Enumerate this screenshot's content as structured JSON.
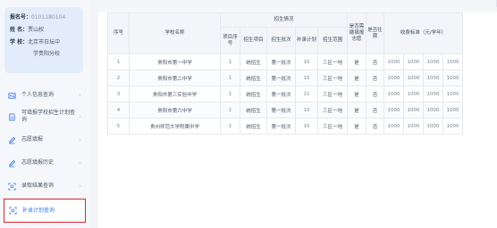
{
  "profile": {
    "exam_no_label": "报名号：",
    "exam_no_value": "0101180104",
    "name_label": "姓  名：",
    "name_value": "贾山权",
    "school_label": "学  校：",
    "school_value_1": "北京市日坛中",
    "school_value_2": "学贵阳分校"
  },
  "menu": [
    {
      "label": "个人信息查询",
      "icon": "id-card-icon"
    },
    {
      "label": "可填报学校招生计划查询",
      "icon": "document-icon"
    },
    {
      "label": "志愿填报",
      "icon": "pen-icon"
    },
    {
      "label": "志愿填报历史",
      "icon": "history-pen-icon"
    },
    {
      "label": "录取结果查询",
      "icon": "result-search-icon"
    },
    {
      "label": "补录计划查询",
      "icon": "plan-search-icon"
    }
  ],
  "table": {
    "headers": {
      "seq": "序号",
      "school": "学校名称",
      "enroll_group": "招生情况",
      "project_seq": "项目序号",
      "project": "招生项目",
      "batch": "招生批次",
      "supplement": "补录计划",
      "range": "招生范围",
      "tuition_required": "是否需缴填报志愿",
      "boarding": "是否住宿",
      "fee": "收费标准（元/学年）"
    },
    "rows": [
      {
        "seq": "1",
        "school": "贵阳市第一中学",
        "pseq": "1",
        "project": "统招生",
        "batch": "第一批次",
        "plan": "10",
        "range": "三区一地",
        "need": "是",
        "board": "否",
        "fees": [
          "1000",
          "1000",
          "1000",
          "1000"
        ]
      },
      {
        "seq": "2",
        "school": "贵阳市第二中学",
        "pseq": "1",
        "project": "统招生",
        "batch": "第一批次",
        "plan": "10",
        "range": "三区一地",
        "need": "是",
        "board": "否",
        "fees": [
          "1000",
          "1000",
          "1000",
          "1000"
        ]
      },
      {
        "seq": "3",
        "school": "贵阳市第三实验中学",
        "pseq": "1",
        "project": "统招生",
        "batch": "第一批次",
        "plan": "11",
        "range": "三区一地",
        "need": "是",
        "board": "否",
        "fees": [
          "1000",
          "1000",
          "1000",
          "1000"
        ]
      },
      {
        "seq": "4",
        "school": "贵阳市第六中学",
        "pseq": "1",
        "project": "统招生",
        "batch": "第一批次",
        "plan": "10",
        "range": "三区一地",
        "need": "是",
        "board": "否",
        "fees": [
          "1000",
          "1000",
          "1000",
          "1000"
        ]
      },
      {
        "seq": "5",
        "school": "贵州师范大学附属中学",
        "pseq": "1",
        "project": "统招生",
        "batch": "第一批次",
        "plan": "10",
        "range": "三区一地",
        "need": "是",
        "board": "否",
        "fees": [
          "1000",
          "1000",
          "1000",
          "1000"
        ]
      }
    ]
  }
}
